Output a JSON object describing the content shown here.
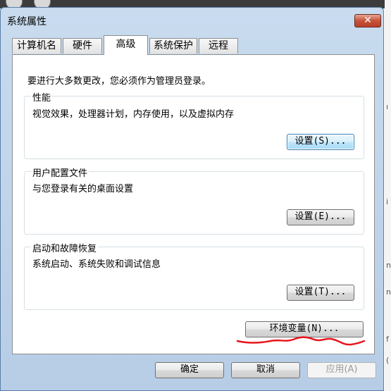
{
  "window": {
    "title": "系统属性",
    "close_label": "✕"
  },
  "tabs": [
    {
      "label": "计算机名"
    },
    {
      "label": "硬件"
    },
    {
      "label": "高级"
    },
    {
      "label": "系统保护"
    },
    {
      "label": "远程"
    }
  ],
  "active_tab": "高级",
  "advanced": {
    "notice": "要进行大多数更改，您必须作为管理员登录。",
    "performance": {
      "label": "性能",
      "description": "视觉效果，处理器计划，内存使用，以及虚拟内存",
      "button": "设置(S)..."
    },
    "user_profiles": {
      "label": "用户配置文件",
      "description": "与您登录有关的桌面设置",
      "button": "设置(E)..."
    },
    "startup_recovery": {
      "label": "启动和故障恢复",
      "description": "系统启动、系统失败和调试信息",
      "button": "设置(T)..."
    },
    "env_button": "环境变量(N)..."
  },
  "footer": {
    "ok": "确定",
    "cancel": "取消",
    "apply": "应用(A)"
  },
  "annotation": {
    "color": "#e8141c"
  },
  "colors": {
    "titlebar": "#b9d1ea",
    "close": "#c6533a",
    "focus": "#3c7fb1"
  }
}
